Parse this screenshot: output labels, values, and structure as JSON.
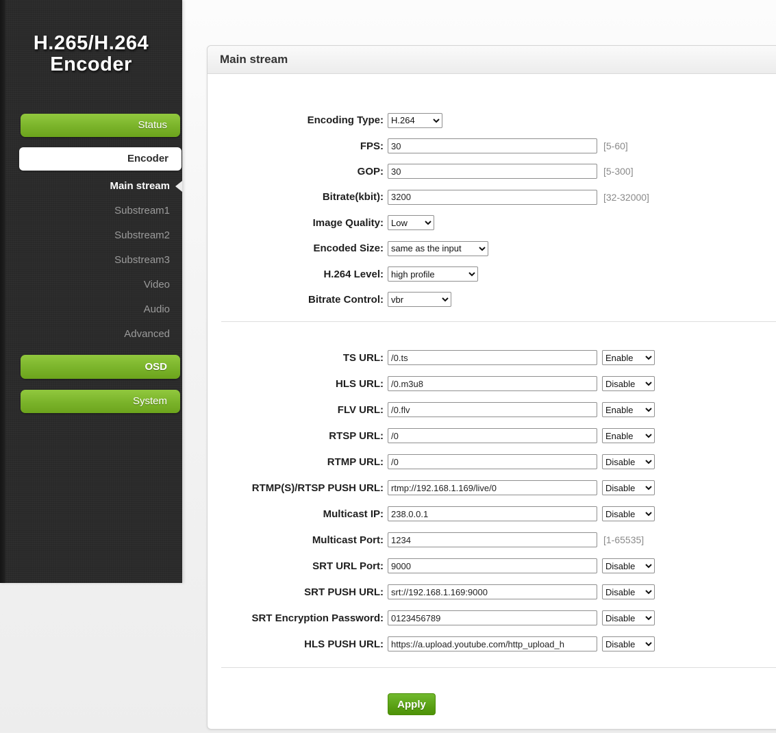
{
  "colors": {
    "accent_green": "#76b02a",
    "sidebar_bg": "#2b2b2b",
    "panel_border": "#d4d4d4",
    "apply_green": "#559c10"
  },
  "sidebar": {
    "logo": {
      "line1": "H.265/H.264",
      "line2": "Encoder"
    },
    "status_label": "Status",
    "encoder_label": "Encoder",
    "encoder_items": [
      {
        "label": "Main stream",
        "active": true
      },
      {
        "label": "Substream1"
      },
      {
        "label": "Substream2"
      },
      {
        "label": "Substream3"
      },
      {
        "label": "Video"
      },
      {
        "label": "Audio"
      },
      {
        "label": "Advanced"
      }
    ],
    "osd_label": "OSD",
    "system_label": "System"
  },
  "panel": {
    "title": "Main stream"
  },
  "form": {
    "encoding": [
      {
        "label": "Encoding Type:",
        "control": "select",
        "value": "H.264"
      },
      {
        "label": "FPS:",
        "control": "input",
        "value": "30",
        "hint": "[5-60]"
      },
      {
        "label": "GOP:",
        "control": "input",
        "value": "30",
        "hint": "[5-300]"
      },
      {
        "label": "Bitrate(kbit):",
        "control": "input",
        "value": "3200",
        "hint": "[32-32000]"
      },
      {
        "label": "Image Quality:",
        "control": "select",
        "value": "Low"
      },
      {
        "label": "Encoded Size:",
        "control": "select",
        "value": "same as the input"
      },
      {
        "label": "H.264 Level:",
        "control": "select",
        "value": "high profile"
      },
      {
        "label": "Bitrate Control:",
        "control": "select",
        "value": "vbr"
      }
    ],
    "urls": [
      {
        "label": "TS URL:",
        "value": "/0.ts",
        "state": "Enable"
      },
      {
        "label": "HLS URL:",
        "value": "/0.m3u8",
        "state": "Disable"
      },
      {
        "label": "FLV URL:",
        "value": "/0.flv",
        "state": "Enable"
      },
      {
        "label": "RTSP URL:",
        "value": "/0",
        "state": "Enable"
      },
      {
        "label": "RTMP URL:",
        "value": "/0",
        "state": "Disable"
      },
      {
        "label": "RTMP(S)/RTSP PUSH URL:",
        "value": "rtmp://192.168.1.169/live/0",
        "state": "Disable"
      },
      {
        "label": "Multicast IP:",
        "value": "238.0.0.1",
        "state": "Disable"
      },
      {
        "label": "Multicast Port:",
        "value": "1234",
        "hint": "[1-65535]"
      },
      {
        "label": "SRT URL Port:",
        "value": "9000",
        "state": "Disable"
      },
      {
        "label": "SRT PUSH URL:",
        "value": "srt://192.168.1.169:9000",
        "state": "Disable"
      },
      {
        "label": "SRT Encryption Password:",
        "value": "0123456789",
        "state": "Disable"
      },
      {
        "label": "HLS PUSH URL:",
        "value": "https://a.upload.youtube.com/http_upload_h",
        "state": "Disable"
      }
    ],
    "apply_label": "Apply"
  }
}
